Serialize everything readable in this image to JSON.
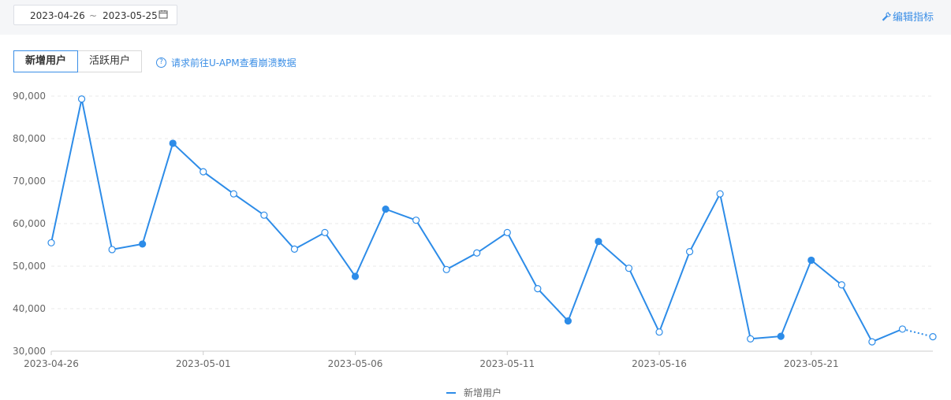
{
  "toolbar": {
    "start_date": "2023-04-26",
    "separator": "~",
    "end_date": "2023-05-25",
    "edit_label": "编辑指标"
  },
  "tabs": [
    {
      "label": "新增用户",
      "active": true
    },
    {
      "label": "活跃用户",
      "active": false
    }
  ],
  "hint": {
    "text": "请求前往U-APM查看崩溃数据"
  },
  "colors": {
    "accent": "#2d8ce8",
    "link": "#3a8ee6"
  },
  "chart_data": {
    "type": "line",
    "x": [
      "2023-04-26",
      "2023-04-27",
      "2023-04-28",
      "2023-04-29",
      "2023-04-30",
      "2023-05-01",
      "2023-05-02",
      "2023-05-03",
      "2023-05-04",
      "2023-05-05",
      "2023-05-06",
      "2023-05-07",
      "2023-05-08",
      "2023-05-09",
      "2023-05-10",
      "2023-05-11",
      "2023-05-12",
      "2023-05-13",
      "2023-05-14",
      "2023-05-15",
      "2023-05-16",
      "2023-05-17",
      "2023-05-18",
      "2023-05-19",
      "2023-05-20",
      "2023-05-21",
      "2023-05-22",
      "2023-05-23",
      "2023-05-24",
      "2023-05-25"
    ],
    "xticks": [
      "2023-04-26",
      "2023-05-01",
      "2023-05-06",
      "2023-05-11",
      "2023-05-16",
      "2023-05-21"
    ],
    "series": [
      {
        "name": "新增用户",
        "values": [
          55500,
          89300,
          53900,
          55200,
          78900,
          72200,
          67000,
          62000,
          54000,
          57900,
          47600,
          63400,
          60800,
          49200,
          53100,
          57900,
          44700,
          37100,
          55800,
          49500,
          34500,
          53400,
          67000,
          32900,
          33500,
          51400,
          45600,
          32200,
          35200,
          33400
        ],
        "filled": [
          false,
          false,
          false,
          true,
          true,
          false,
          false,
          false,
          false,
          false,
          true,
          true,
          false,
          false,
          false,
          false,
          false,
          true,
          true,
          false,
          false,
          false,
          false,
          false,
          true,
          true,
          false,
          false,
          false,
          false
        ],
        "dashed_last_segment": true
      }
    ],
    "ylim": [
      30000,
      90000
    ],
    "yticks": [
      "30,000",
      "40,000",
      "50,000",
      "60,000",
      "70,000",
      "80,000",
      "90,000"
    ],
    "grid": true,
    "legend_position": "bottom-center"
  }
}
